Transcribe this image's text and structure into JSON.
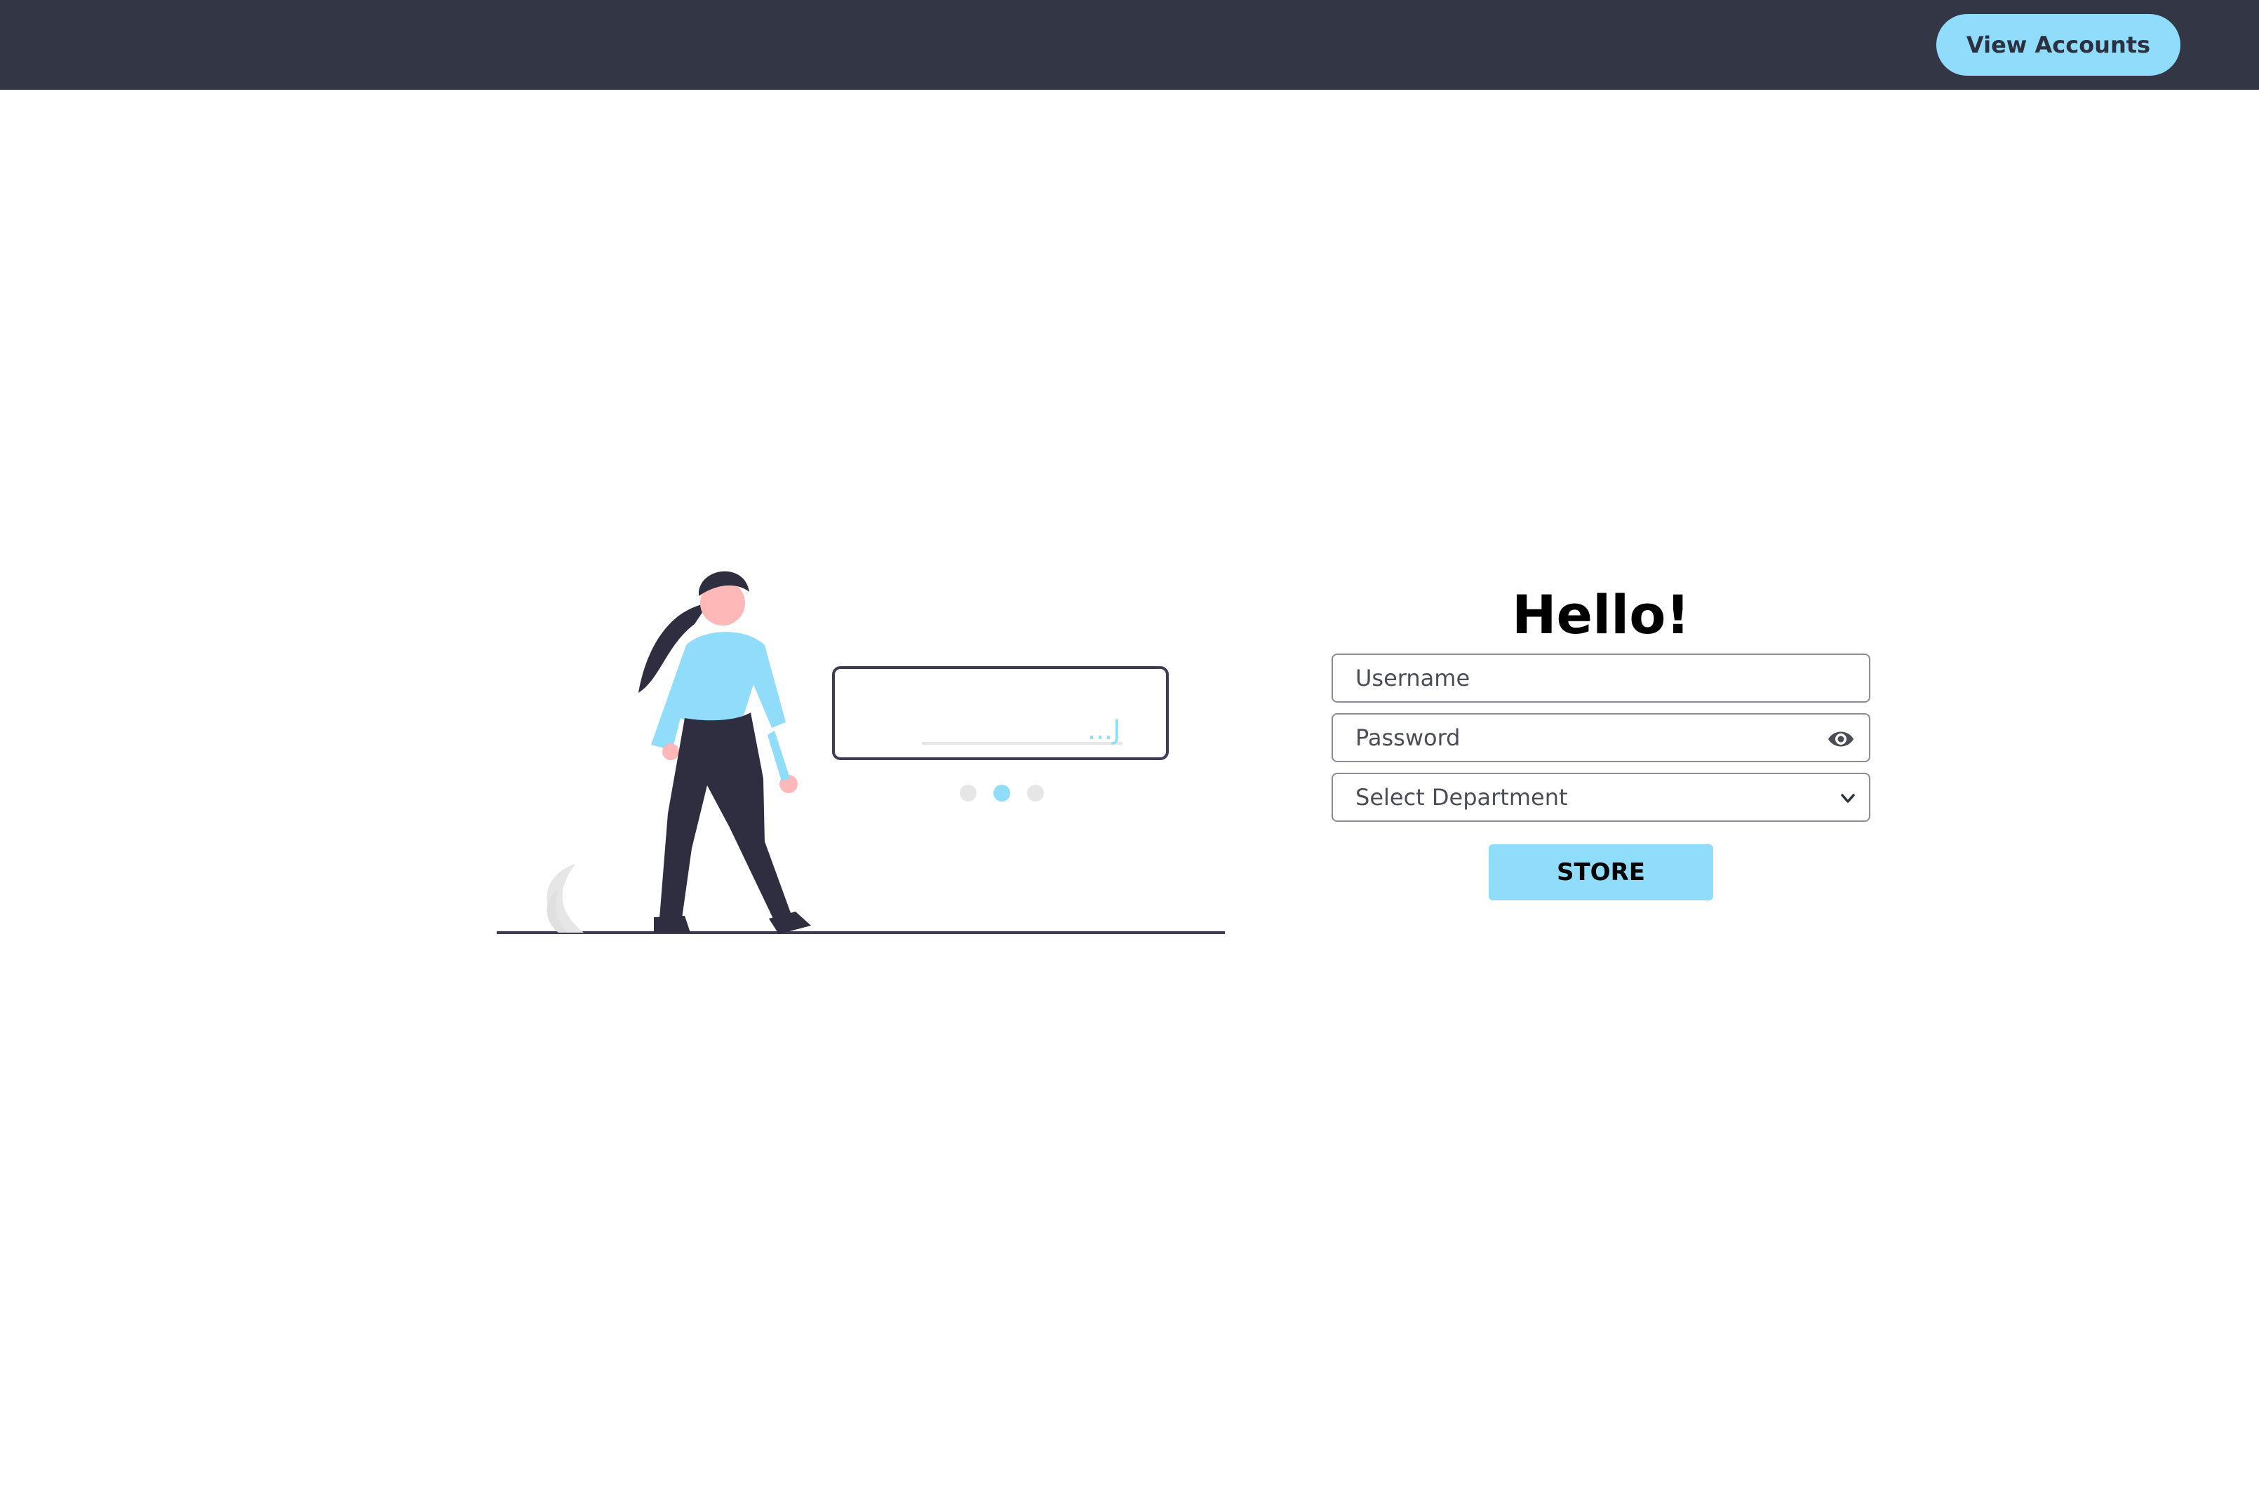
{
  "header": {
    "view_accounts_label": "View Accounts"
  },
  "illustration": {
    "dialog_text": "...J"
  },
  "form": {
    "heading": "Hello!",
    "username_placeholder": "Username",
    "password_placeholder": "Password",
    "department_selected": "Select Department",
    "submit_label": "STORE"
  },
  "colors": {
    "topbar": "#333644",
    "accent": "#8fdcfb",
    "skin": "#ffb8b8",
    "dark": "#2f2e41"
  },
  "icons": {
    "password_toggle": "eye-icon",
    "select_arrow": "chevron-down-icon"
  }
}
